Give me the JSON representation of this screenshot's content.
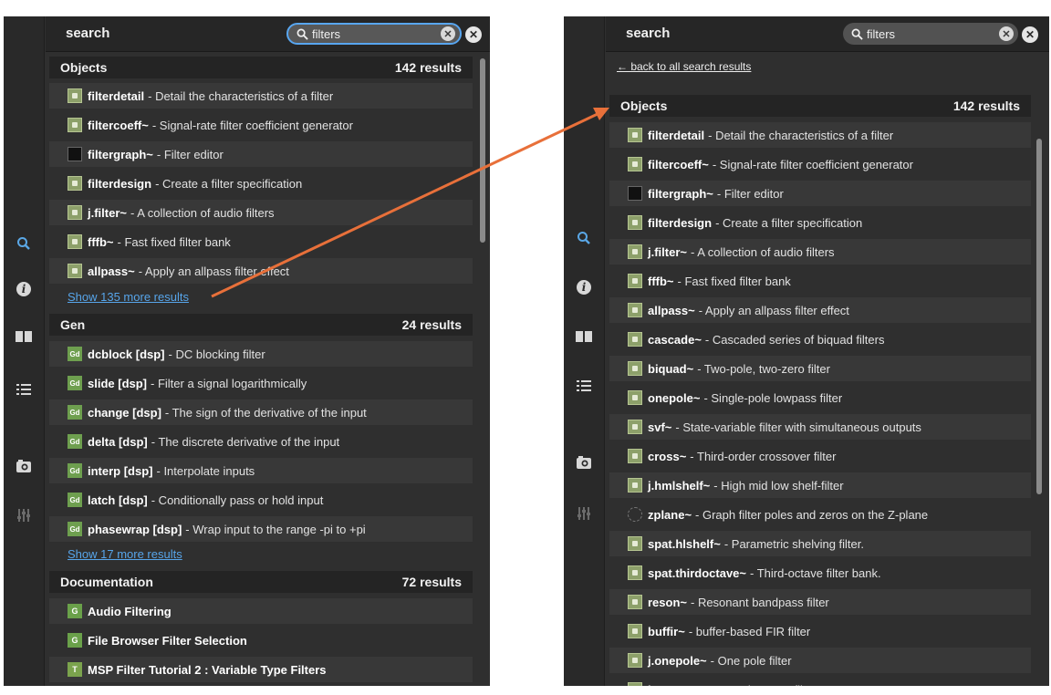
{
  "left": {
    "header_title": "search",
    "search_value": "filters",
    "sections": [
      {
        "title": "Objects",
        "count": "142 results",
        "show_more": "Show 135 more results",
        "items": [
          {
            "icon": "object-icon",
            "name": "filterdetail",
            "desc": "- Detail the characteristics of a filter"
          },
          {
            "icon": "object-icon",
            "name": "filtercoeff~",
            "desc": "- Signal-rate filter coefficient generator"
          },
          {
            "icon": "graph-icon",
            "name": "filtergraph~",
            "desc": "- Filter editor"
          },
          {
            "icon": "object-icon",
            "name": "filterdesign",
            "desc": "- Create a filter specification"
          },
          {
            "icon": "object-icon",
            "name": "j.filter~",
            "desc": "- A collection of audio filters"
          },
          {
            "icon": "object-icon",
            "name": "fffb~",
            "desc": "- Fast fixed filter bank"
          },
          {
            "icon": "object-icon",
            "name": "allpass~",
            "desc": "- Apply an allpass filter effect"
          }
        ]
      },
      {
        "title": "Gen",
        "count": "24 results",
        "show_more": "Show 17 more results",
        "items": [
          {
            "icon": "gen-icon",
            "name": "dcblock [dsp]",
            "desc": "- DC blocking filter"
          },
          {
            "icon": "gen-icon",
            "name": "slide [dsp]",
            "desc": "- Filter a signal logarithmically"
          },
          {
            "icon": "gen-icon",
            "name": "change [dsp]",
            "desc": "- The sign of the derivative of the input"
          },
          {
            "icon": "gen-icon",
            "name": "delta [dsp]",
            "desc": "- The discrete derivative of the input"
          },
          {
            "icon": "gen-icon",
            "name": "interp [dsp]",
            "desc": "- Interpolate inputs"
          },
          {
            "icon": "gen-icon",
            "name": "latch [dsp]",
            "desc": "- Conditionally pass or hold input"
          },
          {
            "icon": "gen-icon",
            "name": "phasewrap [dsp]",
            "desc": "- Wrap input to the range -pi to +pi"
          }
        ]
      },
      {
        "title": "Documentation",
        "count": "72 results",
        "items": [
          {
            "icon": "guide-icon",
            "name": "Audio Filtering",
            "desc": ""
          },
          {
            "icon": "guide-icon",
            "name": "File Browser Filter Selection",
            "desc": ""
          },
          {
            "icon": "tutorial-icon",
            "name": "MSP Filter Tutorial 2 : Variable Type Filters",
            "desc": ""
          }
        ]
      }
    ]
  },
  "right": {
    "header_title": "search",
    "search_value": "filters",
    "back_link": "← back to all search results",
    "section": {
      "title": "Objects",
      "count": "142 results"
    },
    "items": [
      {
        "icon": "object-icon",
        "name": "filterdetail",
        "desc": "- Detail the characteristics of a filter"
      },
      {
        "icon": "object-icon",
        "name": "filtercoeff~",
        "desc": "- Signal-rate filter coefficient generator"
      },
      {
        "icon": "graph-icon",
        "name": "filtergraph~",
        "desc": "- Filter editor"
      },
      {
        "icon": "object-icon",
        "name": "filterdesign",
        "desc": "- Create a filter specification"
      },
      {
        "icon": "object-icon",
        "name": "j.filter~",
        "desc": "- A collection of audio filters"
      },
      {
        "icon": "object-icon",
        "name": "fffb~",
        "desc": "- Fast fixed filter bank"
      },
      {
        "icon": "object-icon",
        "name": "allpass~",
        "desc": "- Apply an allpass filter effect"
      },
      {
        "icon": "object-icon",
        "name": "cascade~",
        "desc": "- Cascaded series of biquad filters"
      },
      {
        "icon": "object-icon",
        "name": "biquad~",
        "desc": "- Two-pole, two-zero filter"
      },
      {
        "icon": "object-icon",
        "name": "onepole~",
        "desc": "- Single-pole lowpass filter"
      },
      {
        "icon": "object-icon",
        "name": "svf~",
        "desc": "- State-variable filter with simultaneous outputs"
      },
      {
        "icon": "object-icon",
        "name": "cross~",
        "desc": "- Third-order crossover filter"
      },
      {
        "icon": "object-icon",
        "name": "j.hmlshelf~",
        "desc": "- High mid low shelf-filter"
      },
      {
        "icon": "zplane-icon",
        "name": "zplane~",
        "desc": "- Graph filter poles and zeros on the Z-plane"
      },
      {
        "icon": "object-icon",
        "name": "spat.hlshelf~",
        "desc": "- Parametric shelving filter."
      },
      {
        "icon": "object-icon",
        "name": "spat.thirdoctave~",
        "desc": "- Third-octave filter bank."
      },
      {
        "icon": "object-icon",
        "name": "reson~",
        "desc": "- Resonant bandpass filter"
      },
      {
        "icon": "object-icon",
        "name": "buffir~",
        "desc": "- buffer-based FIR filter"
      },
      {
        "icon": "object-icon",
        "name": "j.onepole~",
        "desc": "- One pole filter"
      },
      {
        "icon": "object-icon",
        "name": "lores~",
        "desc": "- Resonant lowpass filter"
      }
    ]
  },
  "icon_glyphs": {
    "gen-icon": "Gd",
    "guide-icon": "G",
    "tutorial-icon": "T"
  },
  "colors": {
    "accent": "#58a6f0",
    "link": "#57a5ea",
    "arrow": "#e8703a",
    "panel": "#2f2f2f"
  }
}
